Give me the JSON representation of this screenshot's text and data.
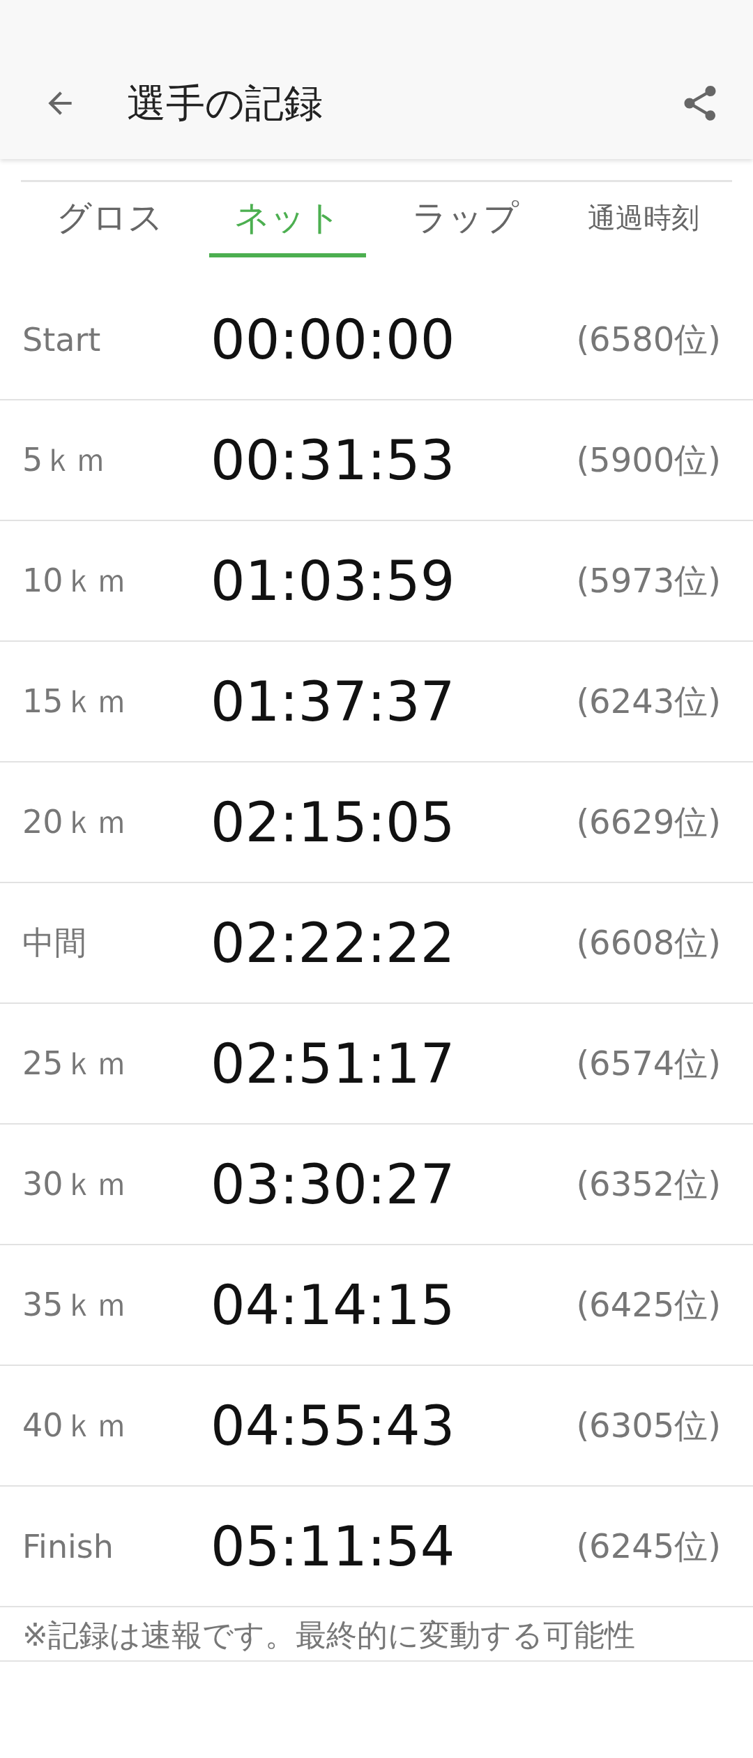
{
  "app_bar": {
    "title": "選手の記録"
  },
  "tabs": [
    {
      "label": "グロス",
      "selected": false
    },
    {
      "label": "ネット",
      "selected": true
    },
    {
      "label": "ラップ",
      "selected": false
    },
    {
      "label": "通過時刻",
      "selected": false
    }
  ],
  "splits": [
    {
      "point": "Start",
      "time": "00:00:00",
      "rank": "(6580位)"
    },
    {
      "point": "5ｋｍ",
      "time": "00:31:53",
      "rank": "(5900位)"
    },
    {
      "point": "10ｋｍ",
      "time": "01:03:59",
      "rank": "(5973位)"
    },
    {
      "point": "15ｋｍ",
      "time": "01:37:37",
      "rank": "(6243位)"
    },
    {
      "point": "20ｋｍ",
      "time": "02:15:05",
      "rank": "(6629位)"
    },
    {
      "point": "中間",
      "time": "02:22:22",
      "rank": "(6608位)"
    },
    {
      "point": "25ｋｍ",
      "time": "02:51:17",
      "rank": "(6574位)"
    },
    {
      "point": "30ｋｍ",
      "time": "03:30:27",
      "rank": "(6352位)"
    },
    {
      "point": "35ｋｍ",
      "time": "04:14:15",
      "rank": "(6425位)"
    },
    {
      "point": "40ｋｍ",
      "time": "04:55:43",
      "rank": "(6305位)"
    },
    {
      "point": "Finish",
      "time": "05:11:54",
      "rank": "(6245位)"
    }
  ],
  "note": "※記録は速報です。最終的に変動する可能性"
}
